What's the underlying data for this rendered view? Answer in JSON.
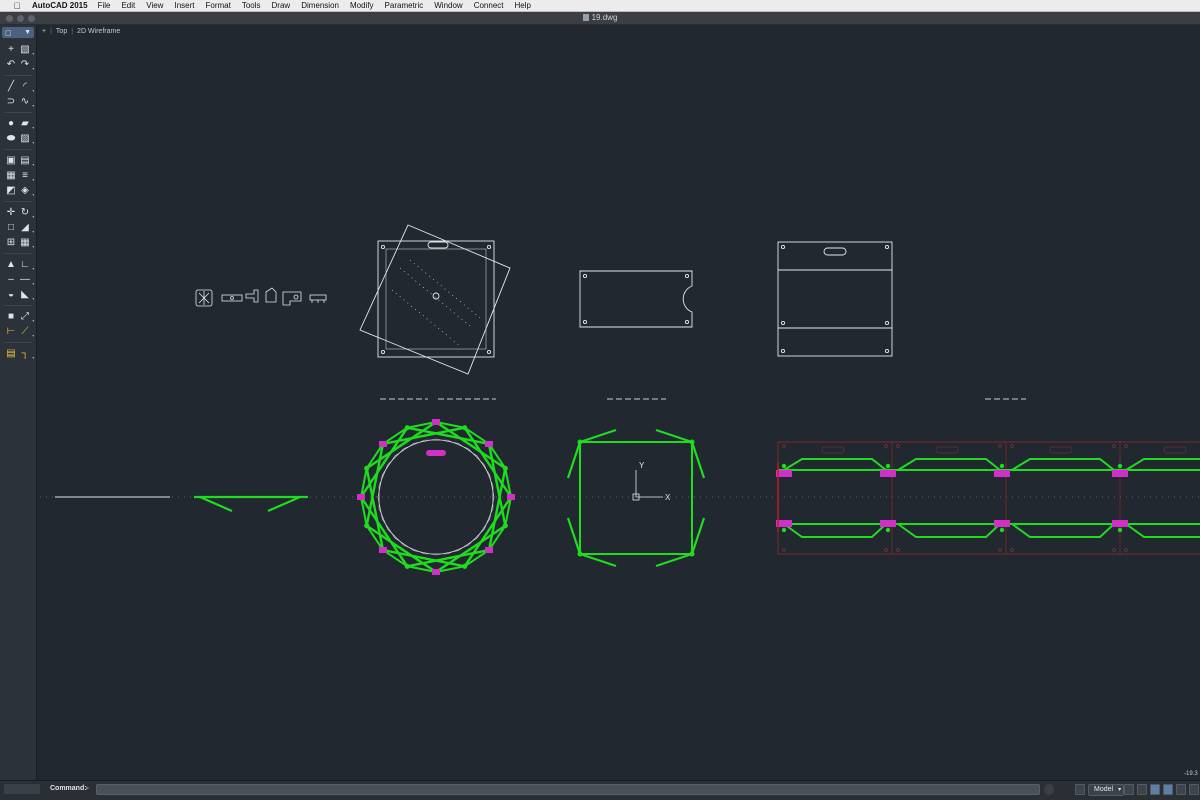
{
  "menubar": {
    "apple": "",
    "app_name": "AutoCAD 2015",
    "items": [
      "File",
      "Edit",
      "View",
      "Insert",
      "Format",
      "Tools",
      "Draw",
      "Dimension",
      "Modify",
      "Parametric",
      "Window",
      "Connect",
      "Help"
    ]
  },
  "window": {
    "title": "19.dwg"
  },
  "viewport": {
    "plus": "+",
    "view": "Top",
    "visual_style": "2D Wireframe"
  },
  "toolbar": {
    "icons": [
      [
        "point-icon",
        "wblock-icon"
      ],
      [
        "undo-icon",
        "redo-icon"
      ],
      [
        "line-icon",
        "arc-icon"
      ],
      [
        "polyline-icon",
        "spline-icon"
      ],
      [
        "circle-icon",
        "rectangle-icon"
      ],
      [
        "ellipse-icon",
        "hatch-icon"
      ],
      [
        "region-icon",
        "boundary-icon"
      ],
      [
        "table-icon",
        "multiline-icon"
      ],
      [
        "text-icon",
        "eraser-icon"
      ],
      [
        "move-icon",
        "rotate-icon"
      ],
      [
        "copy-icon",
        "mirror-icon"
      ],
      [
        "array-icon",
        "offset-icon"
      ],
      [
        "trim-icon",
        "extend-icon"
      ],
      [
        "break-icon",
        "join-icon"
      ],
      [
        "chamfer-icon",
        "fillet-icon"
      ],
      [
        "stretch-icon",
        "scale-icon"
      ],
      [
        "dimension-icon",
        "leader-icon"
      ],
      [
        "layer-icon",
        "match-properties-icon"
      ]
    ]
  },
  "statusbar": {
    "command_label": "Command:",
    "model_tab": "Model",
    "coordinate": "-19.3"
  },
  "colors": {
    "canvas": "#212830",
    "white_geometry": "#e6e8ea",
    "green_geometry": "#1fdc1f",
    "magenta_markers": "#d030c8",
    "red_frame": "#a02828"
  }
}
